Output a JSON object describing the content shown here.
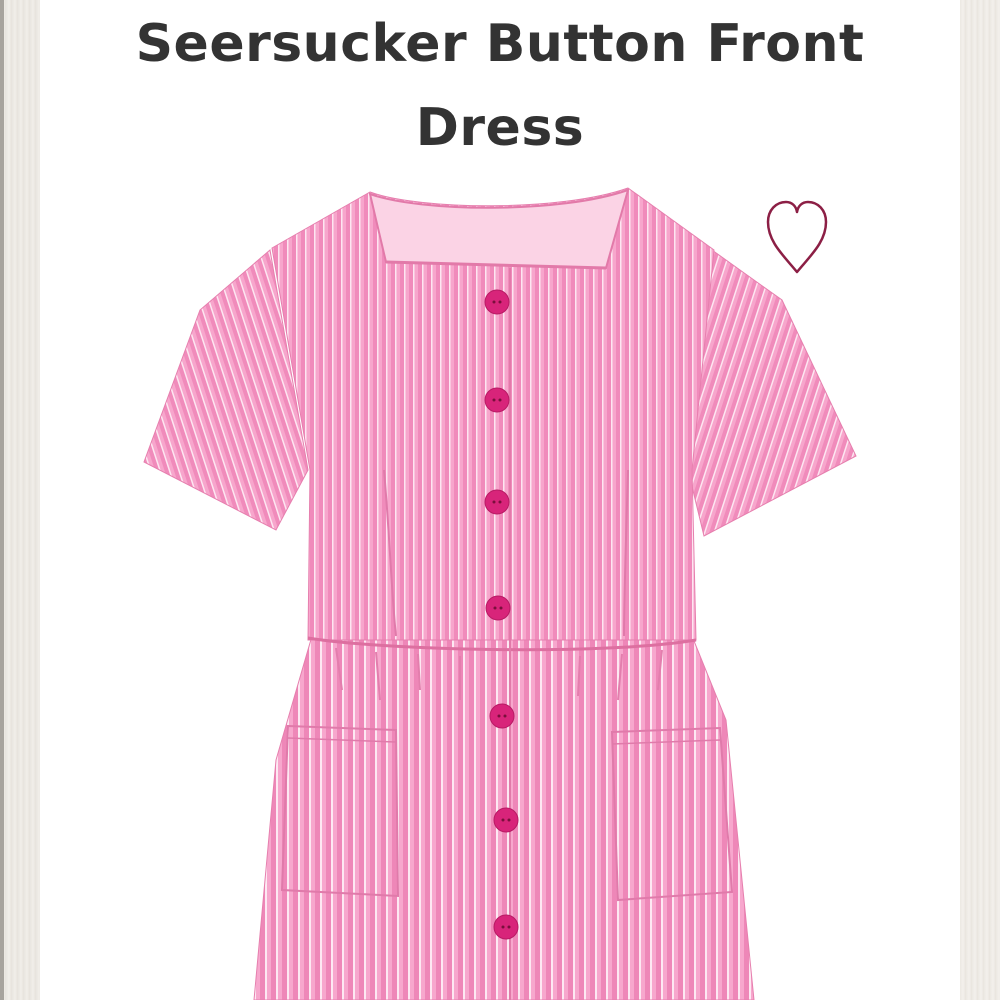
{
  "product": {
    "title": "Seersucker Button Front Dress"
  },
  "icons": {
    "favorite": "heart-outline-icon"
  },
  "colors": {
    "dress_pink": "#f29ac3",
    "stripe_white": "#ffffff",
    "button_magenta": "#d8247a",
    "heart_stroke": "#8c1f45",
    "title_text": "#333333"
  }
}
